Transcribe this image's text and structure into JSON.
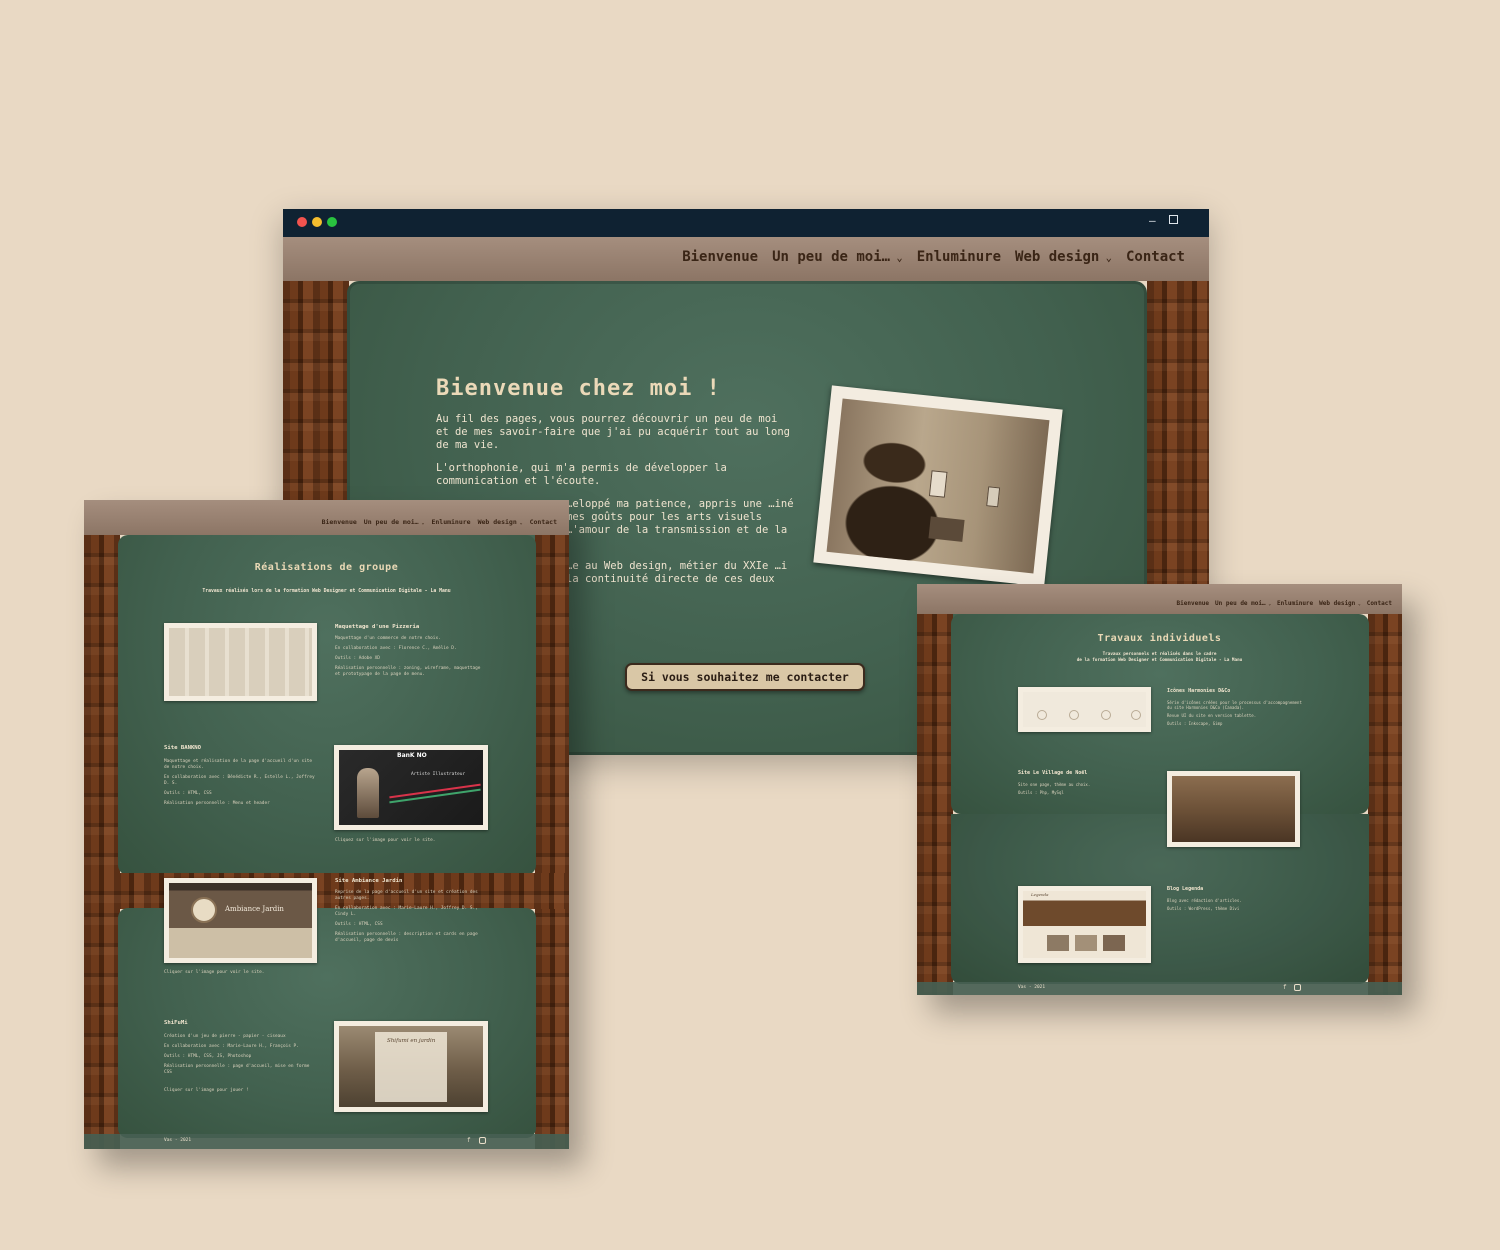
{
  "main": {
    "nav": [
      "Bienvenue",
      "Un peu de moi…",
      "Enluminure",
      "Web design",
      "Contact"
    ],
    "hero_title": "Bienvenue chez moi !",
    "paragraphs": [
      "Au fil des pages, vous pourrez découvrir un peu de moi et de mes savoir-faire que j'ai pu acquérir tout au long de ma vie.",
      "L'orthophonie, qui m'a permis de développer la communication et l'écoute.",
      "…eloppé ma patience, appris une …iné mes goûts pour les arts visuels …'amour de la transmission et de la",
      "…e au Web design, métier du XXIe …i la continuité directe de ces deux"
    ],
    "cta": "Si vous souhaitez me contacter"
  },
  "group": {
    "nav": [
      "Bienvenue",
      "Un peu de moi…",
      "Enluminure",
      "Web design",
      "Contact"
    ],
    "title": "Réalisations de groupe",
    "subtitle": "Travaux réalisés lors de la formation Web Designer et Communication Digitale - La Manu",
    "projects": [
      {
        "title": "Maquettage d'une Pizzeria",
        "lines": [
          "Maquettage d'un commerce de notre choix.",
          "En collaboration avec : Florence C., Amélie D.",
          "Outils : Adobe XD",
          "Réalisation personnelle : zoning, wireframe, maquettage et prototypage de la page de menu."
        ]
      },
      {
        "title": "Site BANKNO",
        "lines": [
          "Maquettage et réalisation de la page d'accueil d'un site de notre choix.",
          "En collaboration avec : Bénédicte R., Estelle L., Joffrey D. S.",
          "Outils : HTML, CSS",
          "Réalisation personnelle : Menu et header"
        ],
        "note": "Cliquez sur l'image pour voir le site."
      },
      {
        "title": "Site Ambiance Jardin",
        "lines": [
          "Reprise de la page d'accueil d'un site et création des autres pages.",
          "En collaboration avec : Marie-Laure H., Joffrey D. S., Cindy L.",
          "Outils : HTML, CSS",
          "Réalisation personnelle : description et cards en page d'accueil, page de devis"
        ],
        "note": "Cliquer sur l'image pour voir le site."
      },
      {
        "title": "ShiFuMi",
        "lines": [
          "Création d'un jeu de pierre - papier - ciseaux",
          "En collaboration avec : Marie-Laure H., François P.",
          "Outils : HTML, CSS, JS, Photoshop",
          "Réalisation personnelle : page d'accueil, mise en forme CSS"
        ],
        "note": "Cliquer sur l'image pour jouer !"
      }
    ],
    "footer": "Vas - 2021",
    "shot_labels": {
      "bankno": "BanK NO",
      "bankno_sub": "Artiste Illustrateur",
      "jardin": "Ambiance Jardin",
      "shifumi": "Shifumi en jardin"
    }
  },
  "individual": {
    "nav": [
      "Bienvenue",
      "Un peu de moi…",
      "Enluminure",
      "Web design",
      "Contact"
    ],
    "title": "Travaux individuels",
    "subtitle1": "Travaux personnels et réalisés dans le cadre",
    "subtitle2": "de la formation Web Designer et Communication Digitale - La Manu",
    "projects": [
      {
        "title": "Icônes Harmonies D&Co",
        "lines": [
          "Série d'icônes créées pour le processus d'accompagnement du site Harmonies D&Co (Canada).",
          "Revue UI du site en version tablette.",
          "Outils : Inkscape, Gimp"
        ]
      },
      {
        "title": "Site Le Village de Noël",
        "lines": [
          "Site one page, thème au choix.",
          "Outils : Php, MySql"
        ]
      },
      {
        "title": "Blog Legenda",
        "lines": [
          "Blog avec rédaction d'articles.",
          "Outils : WordPress, thème Divi"
        ]
      }
    ],
    "footer": "Vas - 2021",
    "shot_labels": {
      "legenda": "Legenda"
    }
  },
  "icons": [
    "facebook-icon",
    "instagram-icon",
    "minimize-icon",
    "maximize-icon"
  ],
  "colors": {
    "background": "#e9d9c4",
    "board": "#42614f",
    "titlebar": "#0f2232",
    "accent": "#d9c7a6"
  }
}
